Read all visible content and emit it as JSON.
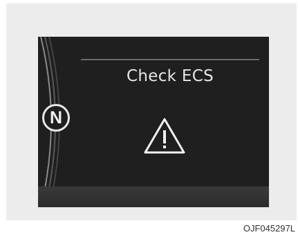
{
  "display": {
    "message": "Check ECS",
    "gear": "N",
    "warning_icon": "warning-triangle-icon"
  },
  "caption": "OJF045297L",
  "colors": {
    "screen_bg": "#1f1f1f",
    "text": "#e6e6e6",
    "panel_bg": "#ececec"
  }
}
